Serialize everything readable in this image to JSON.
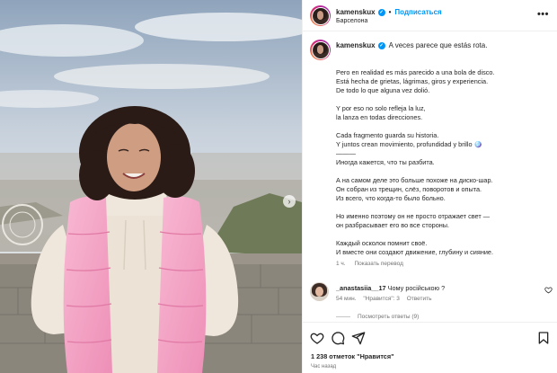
{
  "header": {
    "username": "kamenskux",
    "separator": "•",
    "follow_label": "Подписаться",
    "location": "Барселона",
    "more_glyph": "•••"
  },
  "caption": {
    "username": "kamenskux",
    "first_line": "A veces parece que estás rota.",
    "lines": [
      "",
      "Pero en realidad es más parecido a una bola de disco.",
      "Está hecha de grietas, lágrimas, giros y experiencia.",
      "De todo lo que alguna vez dolió.",
      "",
      "Y por eso no solo refleja la luz,",
      "la lanza en todas direcciones.",
      "",
      "Cada fragmento guarda su historia.",
      "Y juntos crean movimiento, profundidad y brillo 🪩",
      "———",
      "Иногда кажется, что ты разбита.",
      "",
      "А на самом деле это больше похоже на диско-шар.",
      "Он собран из трещин, слёз, поворотов и опыта.",
      "Из всего, что когда-то было больно.",
      "",
      "Но именно поэтому он не просто отражает свет —",
      "он разбрасывает его во все стороны.",
      "",
      "Каждый осколок помнит своё.",
      "И вместе они создают движение, глубину и сияние."
    ],
    "age": "1 ч.",
    "translate_label": "Показать перевод"
  },
  "comment": {
    "username": "_anastasiia__17",
    "text": "Чому російською ?",
    "age": "54 мин.",
    "likes": "\"Нравится\": 3",
    "reply_label": "Ответить",
    "view_replies": "Посмотреть ответы (9)"
  },
  "actions": {
    "likes_text": "1 238 отметок \"Нравится\"",
    "timestamp": "Час назад"
  },
  "media": {
    "next_glyph": "›"
  },
  "colors": {
    "accent": "#0095f6",
    "text": "#262626",
    "muted": "#737373",
    "vest": "#f4a3c4",
    "sky": "#b9c9d8"
  },
  "icons": [
    "verified-icon",
    "heart-icon",
    "comment-icon",
    "share-icon",
    "bookmark-icon",
    "more-icon",
    "chevron-right-icon"
  ]
}
